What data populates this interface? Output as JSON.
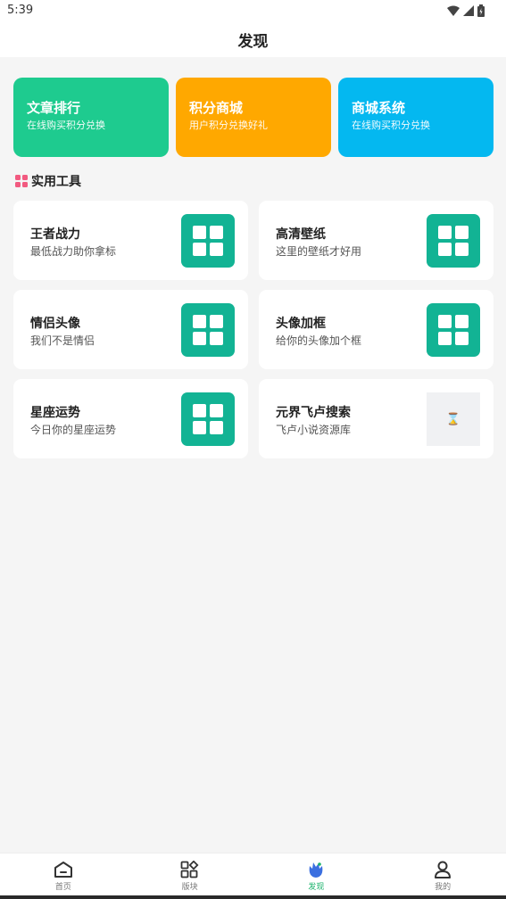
{
  "status_bar": {
    "time": "5:39"
  },
  "header": {
    "title": "发现"
  },
  "banners": [
    {
      "title": "文章排行",
      "subtitle": "在线购买积分兑换",
      "color": "#1ecb8f"
    },
    {
      "title": "积分商城",
      "subtitle": "用户积分兑换好礼",
      "color": "#ffa800"
    },
    {
      "title": "商城系统",
      "subtitle": "在线购买积分兑换",
      "color": "#04b8f0"
    }
  ],
  "section": {
    "title": "实用工具",
    "icon": "grid-icon",
    "icon_color": "#f25a80"
  },
  "tools": [
    {
      "title": "王者战力",
      "subtitle": "最低战力助你拿标",
      "icon": "grid-icon"
    },
    {
      "title": "高清壁纸",
      "subtitle": "这里的壁纸才好用",
      "icon": "grid-icon"
    },
    {
      "title": "情侣头像",
      "subtitle": "我们不是情侣",
      "icon": "grid-icon"
    },
    {
      "title": "头像加框",
      "subtitle": "给你的头像加个框",
      "icon": "grid-icon"
    },
    {
      "title": "星座运势",
      "subtitle": "今日你的星座运势",
      "icon": "grid-icon"
    },
    {
      "title": "元界飞卢搜索",
      "subtitle": "飞卢小说资源库",
      "icon": "hourglass-icon"
    }
  ],
  "tool_icon_color": "#12b394",
  "bottom_nav": [
    {
      "label": "首页",
      "icon": "home-icon"
    },
    {
      "label": "版块",
      "icon": "apps-icon"
    },
    {
      "label": "发现",
      "icon": "discover-icon",
      "active": true
    },
    {
      "label": "我的",
      "icon": "user-icon"
    }
  ],
  "colors": {
    "active_nav": "#1bb36c",
    "background": "#f5f5f5"
  }
}
